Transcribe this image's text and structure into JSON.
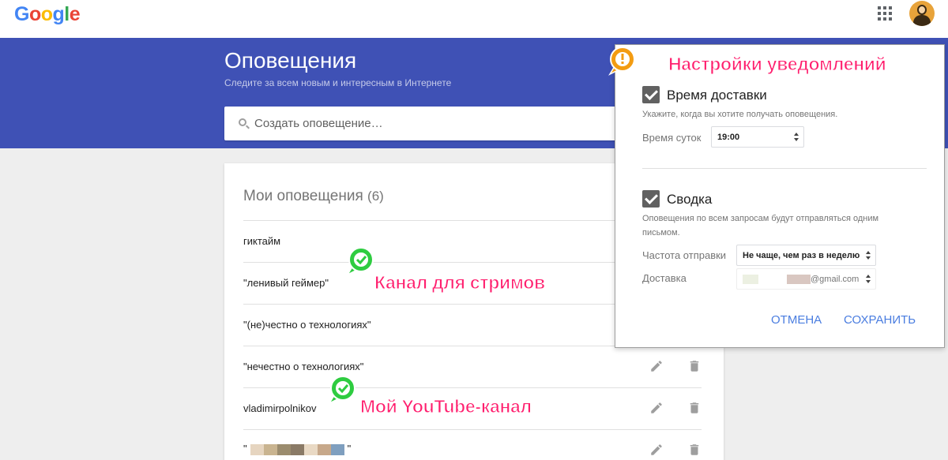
{
  "header": {
    "logo_letters": [
      {
        "ch": "G",
        "color": "#4285f4"
      },
      {
        "ch": "o",
        "color": "#ea4335"
      },
      {
        "ch": "o",
        "color": "#fbbc05"
      },
      {
        "ch": "g",
        "color": "#4285f4"
      },
      {
        "ch": "l",
        "color": "#34a853"
      },
      {
        "ch": "e",
        "color": "#ea4335"
      }
    ],
    "apps_icon": "grid-apps-icon",
    "avatar_icon": "user-avatar"
  },
  "banner": {
    "title": "Оповещения",
    "subtitle": "Следите за всем новым и интересным в Интернете",
    "search_placeholder": "Создать оповещение…",
    "color": "#3f51b5"
  },
  "alerts": {
    "heading": "Мои оповещения",
    "count": "(6)",
    "items": [
      {
        "text": "гиктайм"
      },
      {
        "text": "\"ленивый геймер\""
      },
      {
        "text": "\"(не)честно о технологиях\""
      },
      {
        "text": "\"нечестно о технологиях\""
      },
      {
        "text": "vladimirpolnikov"
      },
      {
        "text_before": "\"",
        "text_after": "\"",
        "blurred_colors": [
          "#e6d5c0",
          "#c9b490",
          "#9b8c6e",
          "#8a7a66",
          "#e9d9c4",
          "#c7a88a",
          "#7f9fbf"
        ]
      }
    ]
  },
  "settings": {
    "delivery_title": "Время доставки",
    "delivery_hint": "Укажите, когда вы хотите получать оповещения.",
    "time_label": "Время суток",
    "time_value": "19:00",
    "digest_title": "Сводка",
    "digest_hint_line1": "Оповещения по всем запросам будут отправляться одним",
    "digest_hint_line2": "письмом.",
    "frequency_label": "Частота отправки",
    "frequency_value": "Не чаще, чем раз в неделю",
    "delivery_label": "Доставка",
    "delivery_email_suffix": "@gmail.com",
    "cancel": "ОТМЕНА",
    "save": "СОХРАНИТЬ"
  },
  "annotations": {
    "settings_note": "Настройки уведомлений",
    "stream_note": "Канал для стримов",
    "youtube_note": "Мой YouTube-канал",
    "note_color": "#ff1f6e"
  }
}
